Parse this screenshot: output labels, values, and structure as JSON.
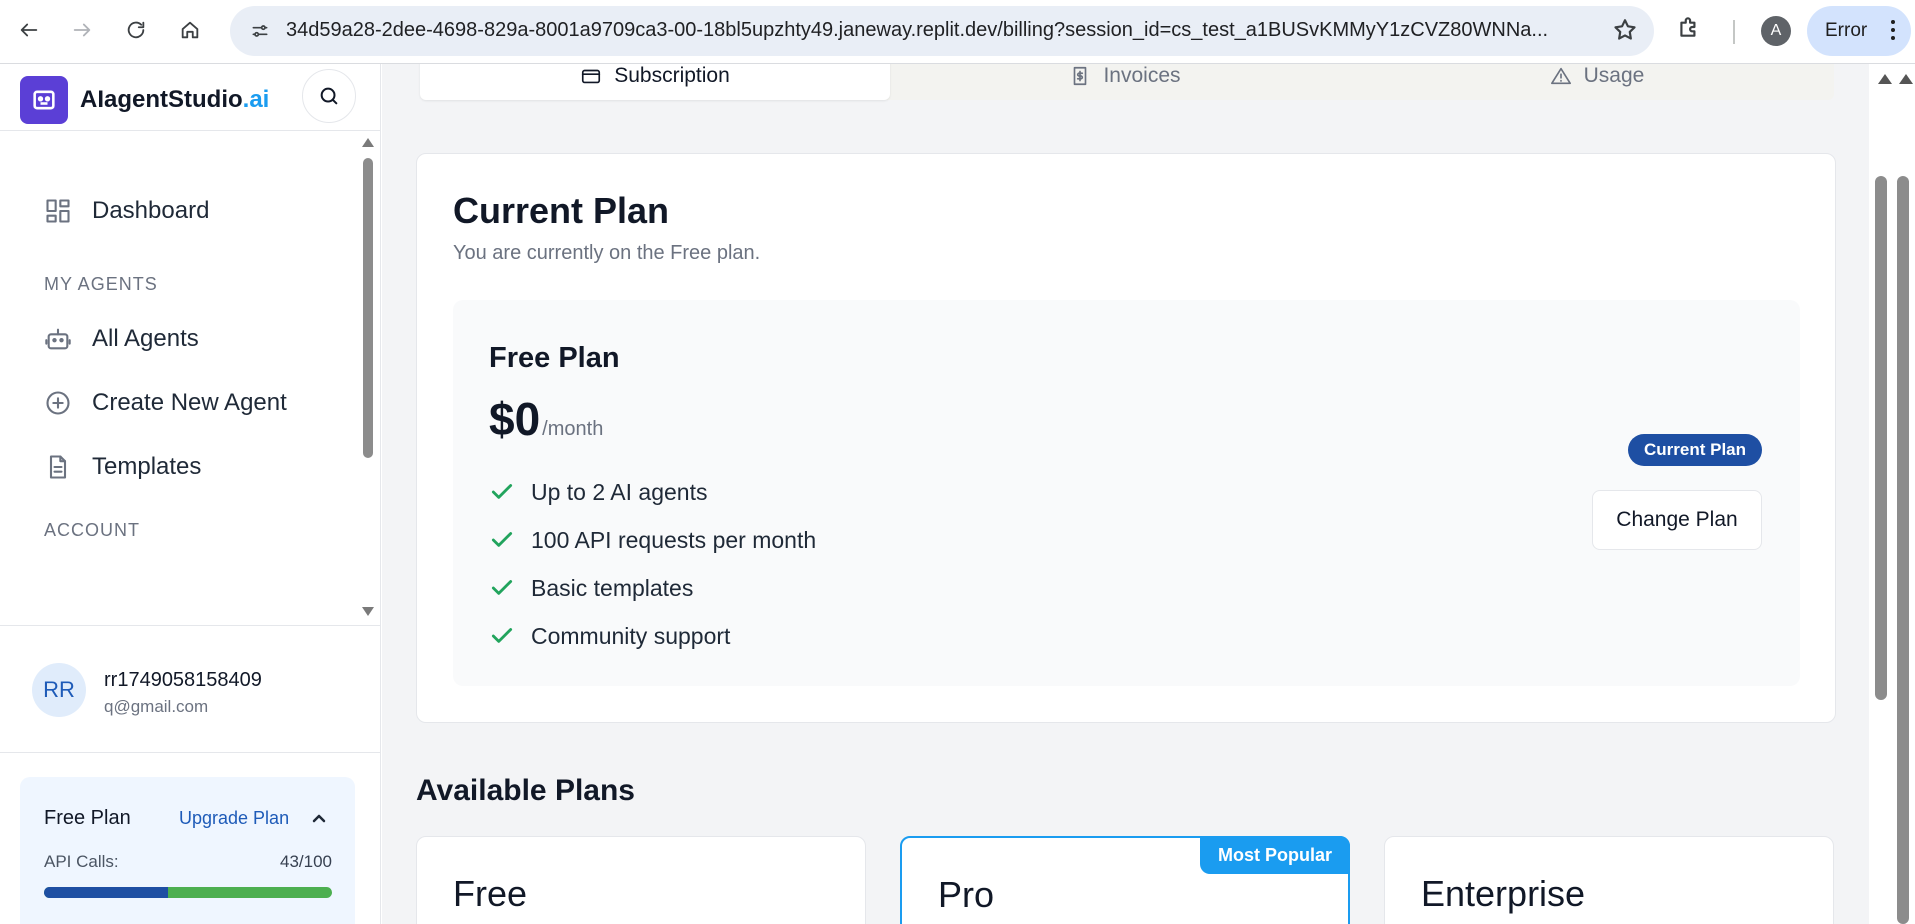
{
  "browser": {
    "url": "34d59a28-2dee-4698-829a-8001a9709ca3-00-18bl5upzhty49.janeway.replit.dev/billing?session_id=cs_test_a1BUSvKMMyY1zCVZ80WNNa...",
    "profile_initial": "A",
    "error_label": "Error"
  },
  "brand": {
    "name": "AIagentStudio",
    "suffix": ".ai"
  },
  "sidebar": {
    "items": [
      {
        "label": "Dashboard",
        "icon": "dashboard-icon"
      },
      {
        "label": "All Agents",
        "icon": "robot-icon"
      },
      {
        "label": "Create New Agent",
        "icon": "plus-circle-icon"
      },
      {
        "label": "Templates",
        "icon": "document-icon"
      }
    ],
    "sections": {
      "my_agents": "MY AGENTS",
      "account": "ACCOUNT"
    },
    "user": {
      "initials": "RR",
      "name": "rr1749058158409",
      "email": "q@gmail.com"
    },
    "plan": {
      "name": "Free Plan",
      "upgrade_label": "Upgrade Plan",
      "api_label": "API Calls:",
      "api_value": "43/100",
      "api_used": 43,
      "api_limit": 100
    }
  },
  "tabs": [
    {
      "label": "Subscription",
      "icon": "credit-card-icon",
      "active": true
    },
    {
      "label": "Invoices",
      "icon": "receipt-icon",
      "active": false
    },
    {
      "label": "Usage",
      "icon": "warning-icon",
      "active": false
    }
  ],
  "current_plan": {
    "title": "Current Plan",
    "subtitle": "You are currently on the Free plan.",
    "plan_name": "Free Plan",
    "price": "$0",
    "period": "/month",
    "features": [
      "Up to 2 AI agents",
      "100 API requests per month",
      "Basic templates",
      "Community support"
    ],
    "badge": "Current Plan",
    "change_button": "Change Plan"
  },
  "available_plans": {
    "title": "Available Plans",
    "plans": [
      {
        "name": "Free"
      },
      {
        "name": "Pro",
        "tag": "Most Popular"
      },
      {
        "name": "Enterprise"
      }
    ]
  },
  "colors": {
    "brand_purple": "#5b3fd6",
    "accent_blue": "#1a9cf0",
    "navy": "#1e4fa3",
    "check_green": "#22a45d",
    "progress_green": "#4caf50"
  }
}
